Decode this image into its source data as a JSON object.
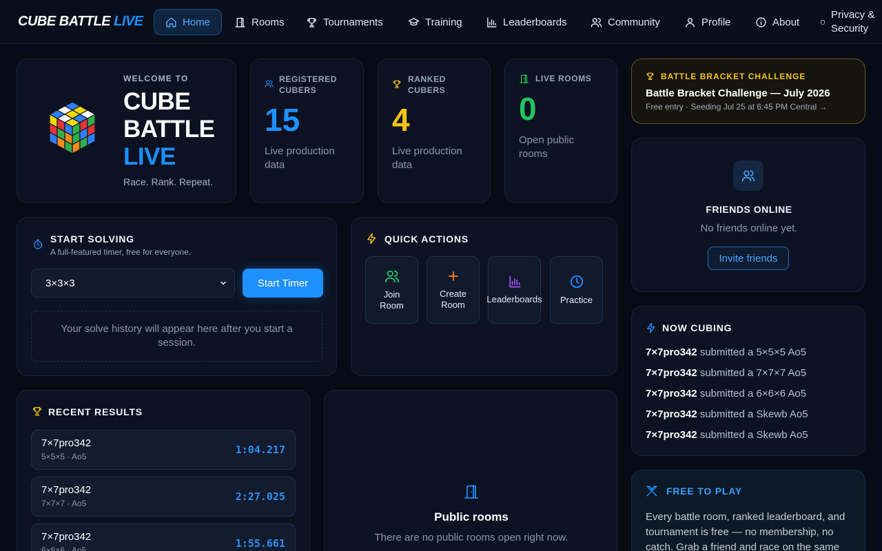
{
  "nav": {
    "logo_main": "CUBE BATTLE",
    "logo_accent": "LIVE",
    "items": [
      {
        "label": "Home",
        "icon": "home-icon"
      },
      {
        "label": "Rooms",
        "icon": "door-icon"
      },
      {
        "label": "Tournaments",
        "icon": "trophy-icon"
      },
      {
        "label": "Training",
        "icon": "graduation-cap-icon"
      },
      {
        "label": "Leaderboards",
        "icon": "bar-chart-icon"
      },
      {
        "label": "Community",
        "icon": "users-icon"
      },
      {
        "label": "Profile",
        "icon": "user-icon"
      },
      {
        "label": "About",
        "icon": "info-icon"
      },
      {
        "label": "Privacy & Security",
        "icon": "shield-icon"
      }
    ]
  },
  "welcome": {
    "eyebrow": "WELCOME TO",
    "line1": "CUBE",
    "line2": "BATTLE",
    "line3": "LIVE",
    "tagline": "Race. Rank. Repeat."
  },
  "stats": [
    {
      "label": "REGISTERED CUBERS",
      "value": "15",
      "sub": "Live production data",
      "color": "#1e90ff"
    },
    {
      "label": "RANKED CUBERS",
      "value": "4",
      "sub": "Live production data",
      "color": "#f5c518"
    },
    {
      "label": "LIVE ROOMS",
      "value": "0",
      "sub": "Open public rooms",
      "color": "#22c55e"
    }
  ],
  "bracket": {
    "badge": "BATTLE BRACKET CHALLENGE",
    "title": "Battle Bracket Challenge — July 2026",
    "sub": "Free entry · Seeding Jul 25 at 6:45 PM Central →"
  },
  "friends": {
    "title": "FRIENDS ONLINE",
    "empty": "No friends online yet.",
    "invite": "Invite friends"
  },
  "start_solving": {
    "title": "START SOLVING",
    "subtitle": "A full-featured timer, free for everyone.",
    "puzzle_selected": "3×3×3",
    "start_label": "Start Timer",
    "history_empty": "Your solve history will appear here after you start a session."
  },
  "quick_actions": {
    "title": "QUICK ACTIONS",
    "tiles": [
      {
        "label": "Join Room",
        "icon": "users-icon"
      },
      {
        "label": "Create Room",
        "icon": "plus-icon"
      },
      {
        "label": "Leaderboards",
        "icon": "bar-chart-icon"
      },
      {
        "label": "Practice",
        "icon": "clock-icon"
      }
    ]
  },
  "now_cubing": {
    "title": "NOW CUBING",
    "items": [
      {
        "user": "7×7pro342",
        "text": "submitted a 5×5×5 Ao5"
      },
      {
        "user": "7×7pro342",
        "text": "submitted a 7×7×7 Ao5"
      },
      {
        "user": "7×7pro342",
        "text": "submitted a 6×6×6 Ao5"
      },
      {
        "user": "7×7pro342",
        "text": "submitted a Skewb Ao5"
      },
      {
        "user": "7×7pro342",
        "text": "submitted a Skewb Ao5"
      }
    ]
  },
  "recent_results": {
    "title": "RECENT RESULTS",
    "rows": [
      {
        "user": "7×7pro342",
        "meta": "5×5×5 · Ao5",
        "time": "1:04.217"
      },
      {
        "user": "7×7pro342",
        "meta": "7×7×7 · Ao5",
        "time": "2:27.025"
      },
      {
        "user": "7×7pro342",
        "meta": "6×6×6 · Ao5",
        "time": "1:55.661"
      }
    ]
  },
  "public_rooms": {
    "title": "Public rooms",
    "empty": "There are no public rooms open right now."
  },
  "free_to_play": {
    "title": "FREE TO PLAY",
    "body": "Every battle room, ranked leaderboard, and tournament is free — no membership, no catch. Grab a friend and race on the same"
  },
  "colors": {
    "accent": "#1e90ff",
    "gold": "#f5c518",
    "green": "#22c55e",
    "orange": "#f97316",
    "purple": "#a855f7"
  }
}
